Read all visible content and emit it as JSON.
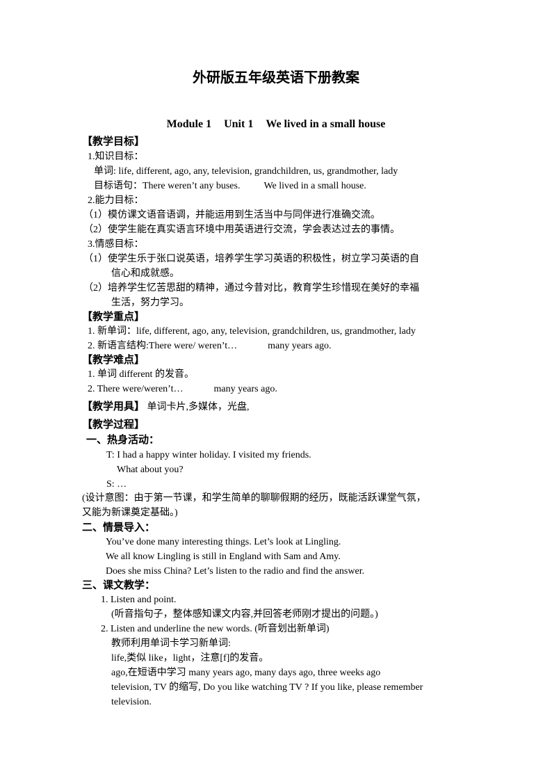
{
  "title": "外研版五年级英语下册教案",
  "subtitle": {
    "module": "Module 1",
    "unit": "Unit 1",
    "lesson": "We lived in a small house"
  },
  "objectives": {
    "heading": "【教学目标】",
    "knowledge_label": "1.知识目标：",
    "words": "单词: life, different, ago, any, television, grandchildren, us, grandmother, lady",
    "sentences_label": "目标语句：",
    "sentence_1": "There weren’t any buses.",
    "sentence_2": "We lived in a small house.",
    "ability_label": "2.能力目标：",
    "ability_1": "（1）模仿课文语音语调，并能运用到生活当中与同伴进行准确交流。",
    "ability_2": "（2）使学生能在真实语言环境中用英语进行交流，学会表达过去的事情。",
    "emotion_label": "3.情感目标：",
    "emotion_1a": "（1）使学生乐于张口说英语，培养学生学习英语的积极性，树立学习英语的自",
    "emotion_1b": "信心和成就感。",
    "emotion_2a": "（2）培养学生忆苦思甜的精神，通过今昔对比，教育学生珍惜现在美好的幸福",
    "emotion_2b": "生活，努力学习。"
  },
  "key_points": {
    "heading": "【教学重点】",
    "item_1": "1. 新单词：life, different, ago, any, television, grandchildren, us, grandmother, lady",
    "item_2a": "2. 新语言结构:There were/ weren’t…",
    "item_2b": "many years ago."
  },
  "difficulties": {
    "heading": "【教学难点】",
    "item_1": "1. 单词 different 的发音。",
    "item_2a": "2. There were/weren’t…",
    "item_2b": "many years ago."
  },
  "tools": {
    "heading": "【教学用具】",
    "text": "单词卡片,多媒体，光盘,"
  },
  "process": {
    "heading": "【教学过程】",
    "warmup": {
      "heading": "一、热身活动：",
      "t1": "T: I had a happy winter holiday. I visited my friends.",
      "t2": "What about you?",
      "s": "S: …",
      "note_a": "(设计意图：由于第一节课，和学生简单的聊聊假期的经历，既能活跃课堂气氛，",
      "note_b": "又能为新课奠定基础。)"
    },
    "lead_in": {
      "heading": "二、情景导入：",
      "l1": "You’ve done many interesting things. Let’s look at Lingling.",
      "l2": "We all know Lingling is still in England with Sam and Amy.",
      "l3": "Does she miss China? Let’s listen to the radio and find the answer."
    },
    "text_teaching": {
      "heading": "三、课文教学：",
      "step1": "1. Listen and point.",
      "step1_note": "(听音指句子，整体感知课文内容,并回答老师刚才提出的问题。)",
      "step2": "2. Listen and underline the new words. (听音划出新单词)",
      "step2_a": "教师利用单词卡学习新单词:",
      "step2_b": "life,类似 like，light，注意[f]的发音。",
      "step2_c": "ago,在短语中学习 many years ago, many days ago, three weeks ago",
      "step2_d": "television, TV 的缩写, Do you like watching TV ? If you like, please remember",
      "step2_e": "television."
    }
  }
}
